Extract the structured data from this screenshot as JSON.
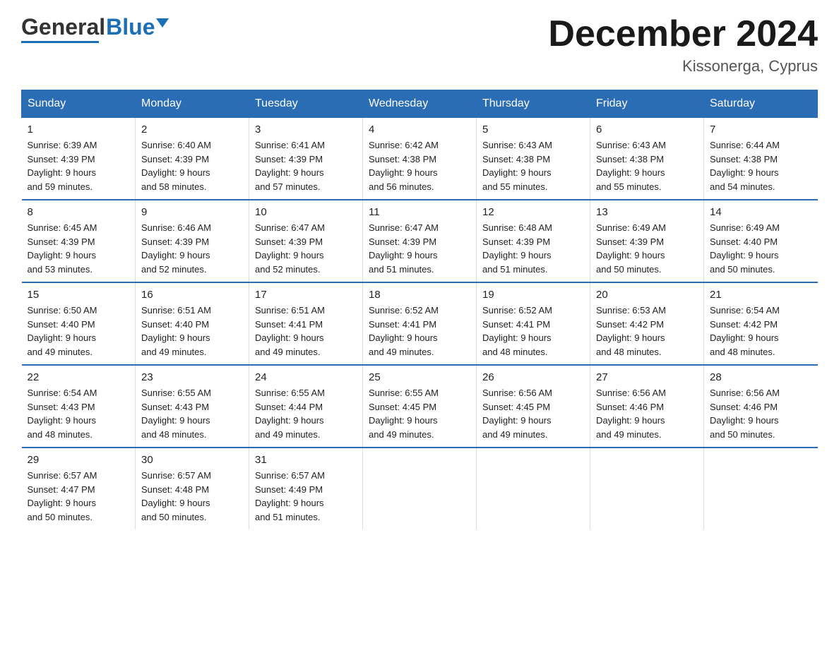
{
  "header": {
    "logo_general": "General",
    "logo_blue": "Blue",
    "title": "December 2024",
    "subtitle": "Kissonerga, Cyprus"
  },
  "days_of_week": [
    "Sunday",
    "Monday",
    "Tuesday",
    "Wednesday",
    "Thursday",
    "Friday",
    "Saturday"
  ],
  "weeks": [
    [
      {
        "day": "1",
        "sunrise": "6:39 AM",
        "sunset": "4:39 PM",
        "daylight": "9 hours and 59 minutes."
      },
      {
        "day": "2",
        "sunrise": "6:40 AM",
        "sunset": "4:39 PM",
        "daylight": "9 hours and 58 minutes."
      },
      {
        "day": "3",
        "sunrise": "6:41 AM",
        "sunset": "4:39 PM",
        "daylight": "9 hours and 57 minutes."
      },
      {
        "day": "4",
        "sunrise": "6:42 AM",
        "sunset": "4:38 PM",
        "daylight": "9 hours and 56 minutes."
      },
      {
        "day": "5",
        "sunrise": "6:43 AM",
        "sunset": "4:38 PM",
        "daylight": "9 hours and 55 minutes."
      },
      {
        "day": "6",
        "sunrise": "6:43 AM",
        "sunset": "4:38 PM",
        "daylight": "9 hours and 55 minutes."
      },
      {
        "day": "7",
        "sunrise": "6:44 AM",
        "sunset": "4:38 PM",
        "daylight": "9 hours and 54 minutes."
      }
    ],
    [
      {
        "day": "8",
        "sunrise": "6:45 AM",
        "sunset": "4:39 PM",
        "daylight": "9 hours and 53 minutes."
      },
      {
        "day": "9",
        "sunrise": "6:46 AM",
        "sunset": "4:39 PM",
        "daylight": "9 hours and 52 minutes."
      },
      {
        "day": "10",
        "sunrise": "6:47 AM",
        "sunset": "4:39 PM",
        "daylight": "9 hours and 52 minutes."
      },
      {
        "day": "11",
        "sunrise": "6:47 AM",
        "sunset": "4:39 PM",
        "daylight": "9 hours and 51 minutes."
      },
      {
        "day": "12",
        "sunrise": "6:48 AM",
        "sunset": "4:39 PM",
        "daylight": "9 hours and 51 minutes."
      },
      {
        "day": "13",
        "sunrise": "6:49 AM",
        "sunset": "4:39 PM",
        "daylight": "9 hours and 50 minutes."
      },
      {
        "day": "14",
        "sunrise": "6:49 AM",
        "sunset": "4:40 PM",
        "daylight": "9 hours and 50 minutes."
      }
    ],
    [
      {
        "day": "15",
        "sunrise": "6:50 AM",
        "sunset": "4:40 PM",
        "daylight": "9 hours and 49 minutes."
      },
      {
        "day": "16",
        "sunrise": "6:51 AM",
        "sunset": "4:40 PM",
        "daylight": "9 hours and 49 minutes."
      },
      {
        "day": "17",
        "sunrise": "6:51 AM",
        "sunset": "4:41 PM",
        "daylight": "9 hours and 49 minutes."
      },
      {
        "day": "18",
        "sunrise": "6:52 AM",
        "sunset": "4:41 PM",
        "daylight": "9 hours and 49 minutes."
      },
      {
        "day": "19",
        "sunrise": "6:52 AM",
        "sunset": "4:41 PM",
        "daylight": "9 hours and 48 minutes."
      },
      {
        "day": "20",
        "sunrise": "6:53 AM",
        "sunset": "4:42 PM",
        "daylight": "9 hours and 48 minutes."
      },
      {
        "day": "21",
        "sunrise": "6:54 AM",
        "sunset": "4:42 PM",
        "daylight": "9 hours and 48 minutes."
      }
    ],
    [
      {
        "day": "22",
        "sunrise": "6:54 AM",
        "sunset": "4:43 PM",
        "daylight": "9 hours and 48 minutes."
      },
      {
        "day": "23",
        "sunrise": "6:55 AM",
        "sunset": "4:43 PM",
        "daylight": "9 hours and 48 minutes."
      },
      {
        "day": "24",
        "sunrise": "6:55 AM",
        "sunset": "4:44 PM",
        "daylight": "9 hours and 49 minutes."
      },
      {
        "day": "25",
        "sunrise": "6:55 AM",
        "sunset": "4:45 PM",
        "daylight": "9 hours and 49 minutes."
      },
      {
        "day": "26",
        "sunrise": "6:56 AM",
        "sunset": "4:45 PM",
        "daylight": "9 hours and 49 minutes."
      },
      {
        "day": "27",
        "sunrise": "6:56 AM",
        "sunset": "4:46 PM",
        "daylight": "9 hours and 49 minutes."
      },
      {
        "day": "28",
        "sunrise": "6:56 AM",
        "sunset": "4:46 PM",
        "daylight": "9 hours and 50 minutes."
      }
    ],
    [
      {
        "day": "29",
        "sunrise": "6:57 AM",
        "sunset": "4:47 PM",
        "daylight": "9 hours and 50 minutes."
      },
      {
        "day": "30",
        "sunrise": "6:57 AM",
        "sunset": "4:48 PM",
        "daylight": "9 hours and 50 minutes."
      },
      {
        "day": "31",
        "sunrise": "6:57 AM",
        "sunset": "4:49 PM",
        "daylight": "9 hours and 51 minutes."
      },
      {
        "day": "",
        "sunrise": "",
        "sunset": "",
        "daylight": ""
      },
      {
        "day": "",
        "sunrise": "",
        "sunset": "",
        "daylight": ""
      },
      {
        "day": "",
        "sunrise": "",
        "sunset": "",
        "daylight": ""
      },
      {
        "day": "",
        "sunrise": "",
        "sunset": "",
        "daylight": ""
      }
    ]
  ],
  "labels": {
    "sunrise": "Sunrise:",
    "sunset": "Sunset:",
    "daylight": "Daylight:"
  }
}
